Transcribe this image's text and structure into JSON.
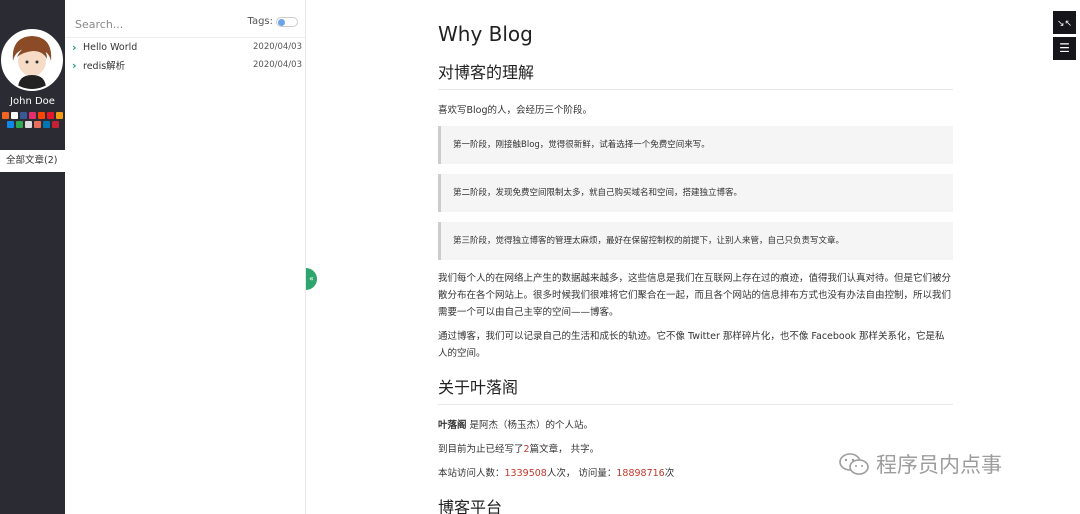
{
  "sidebar": {
    "author": "John Doe",
    "all_posts": "全部文章(2)",
    "social_icons": [
      {
        "name": "rss-icon",
        "color": "#f26522"
      },
      {
        "name": "github-icon",
        "color": "#ffffff"
      },
      {
        "name": "facebook-icon",
        "color": "#3b5998"
      },
      {
        "name": "instagram-icon",
        "color": "#e1306c"
      },
      {
        "name": "reddit-icon",
        "color": "#ff4500"
      },
      {
        "name": "weibo-icon",
        "color": "#e6162d"
      },
      {
        "name": "rss2-icon",
        "color": "#f39c12"
      },
      {
        "name": "zhihu-icon",
        "color": "#0f88eb"
      },
      {
        "name": "douban-icon",
        "color": "#2fa84f"
      },
      {
        "name": "mail-icon",
        "color": "#dddddd"
      },
      {
        "name": "jianshu-icon",
        "color": "#ea6f5a"
      },
      {
        "name": "linkedin-icon",
        "color": "#0077b5"
      },
      {
        "name": "csdn-icon",
        "color": "#c32136"
      }
    ]
  },
  "list": {
    "search_placeholder": "Search...",
    "tags_label": "Tags:",
    "posts": [
      {
        "title": "Hello World",
        "date": "2020/04/03"
      },
      {
        "title": "redis解析",
        "date": "2020/04/03"
      }
    ]
  },
  "floating": {
    "expand_icon": "↘↖",
    "toc_icon": "☰"
  },
  "article": {
    "title": "Why Blog",
    "section1": "对博客的理解",
    "intro": "喜欢写Blog的人，会经历三个阶段。",
    "quotes": [
      "第一阶段，刚接触Blog，觉得很新鲜，试着选择一个免费空间来写。",
      "第二阶段，发现免费空间限制太多，就自己购买域名和空间，搭建独立博客。",
      "第三阶段，觉得独立博客的管理太麻烦，最好在保留控制权的前提下，让别人来管，自己只负责写文章。"
    ],
    "para1": "我们每个人的在网络上产生的数据越来越多，这些信息是我们在互联网上存在过的痕迹，值得我们认真对待。但是它们被分散分布在各个网站上。很多时候我们很难将它们聚合在一起，而且各个网站的信息排布方式也没有办法自由控制，所以我们需要一个可以由自己主宰的空间——博客。",
    "para2": "通过博客，我们可以记录自己的生活和成长的轨迹。它不像 Twitter 那样碎片化，也不像 Facebook 那样关系化，它是私人的空间。",
    "section2": "关于叶落阁",
    "about_name": "叶落阁",
    "about_rest": " 是阿杰（杨玉杰）的个人站。",
    "count_pre": "到目前为止已经写了",
    "count_num": "2",
    "count_post": "篇文章， 共字。",
    "visit_pre": "本站访问人数：",
    "visitors": "1339508",
    "visit_mid": "人次， 访问量：",
    "views": "18898716",
    "visit_post": "次",
    "section3": "博客平台"
  },
  "watermark": "程序员内点事"
}
